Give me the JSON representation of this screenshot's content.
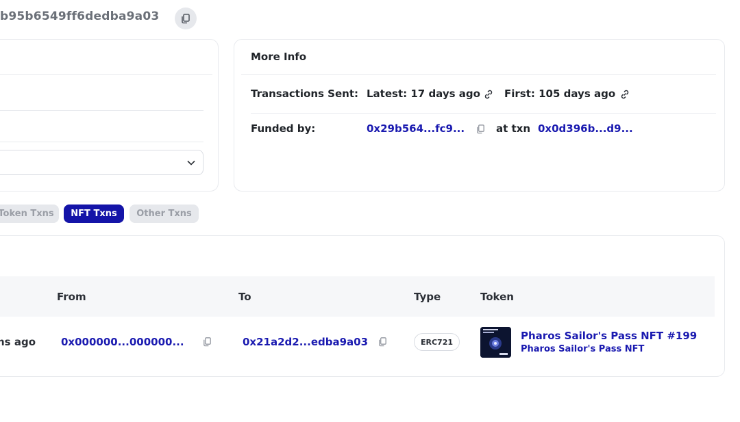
{
  "header": {
    "address_fragment": "b95b6549ff6dedba9a03"
  },
  "more_info": {
    "title": "More Info",
    "transactions_sent_label": "Transactions Sent:",
    "latest": "Latest: 17 days ago",
    "first": "First: 105 days ago",
    "funded_by_label": "Funded by:",
    "funded_by_address": "0x29b564...fc9...",
    "at_txn_label": "at txn",
    "txn_hash": "0x0d396b...d9..."
  },
  "tabs": [
    {
      "label": "Token Txns",
      "active": false
    },
    {
      "label": "NFT Txns",
      "active": true
    },
    {
      "label": "Other Txns",
      "active": false
    }
  ],
  "table": {
    "headers": [
      "From",
      "To",
      "Type",
      "Token"
    ],
    "rows": [
      {
        "age": "ns ago",
        "from": "0x000000...000000...",
        "to": "0x21a2d2...edba9a03",
        "type": "ERC721",
        "token_name": "Pharos Sailor's Pass NFT #199",
        "token_collection": "Pharos Sailor's Pass NFT"
      }
    ]
  },
  "colors": {
    "accent": "#1414a8",
    "link": "#1a1ab0",
    "border": "#e8eaee",
    "muted": "#9a9ea6"
  }
}
